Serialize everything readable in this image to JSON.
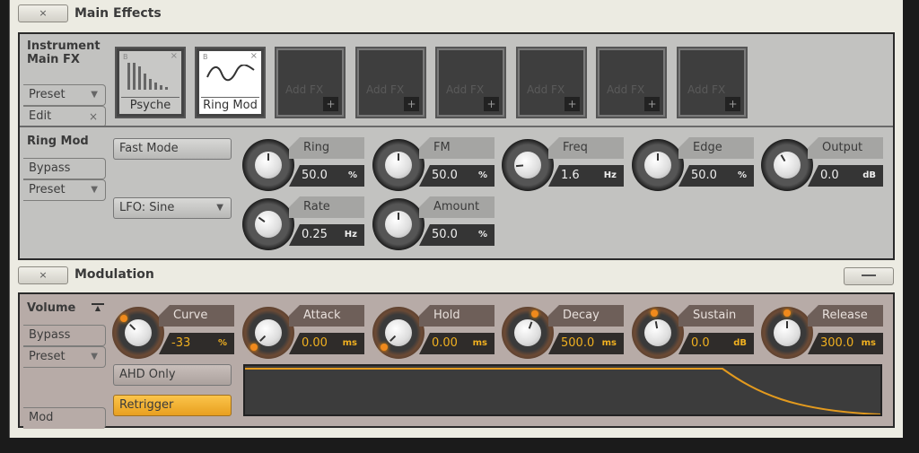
{
  "main_effects": {
    "title": "Main Effects",
    "close_label": "×",
    "section_label": "Instrument Main FX",
    "preset_label": "Preset",
    "edit_label": "Edit",
    "edit_close": "×",
    "slots": [
      {
        "name": "Psyche",
        "bypass": "B",
        "close": "×",
        "state": "loaded"
      },
      {
        "name": "Ring Mod",
        "bypass": "B",
        "close": "×",
        "state": "selected"
      },
      {
        "name": "Add FX",
        "state": "empty"
      },
      {
        "name": "Add FX",
        "state": "empty"
      },
      {
        "name": "Add FX",
        "state": "empty"
      },
      {
        "name": "Add FX",
        "state": "empty"
      },
      {
        "name": "Add FX",
        "state": "empty"
      },
      {
        "name": "Add FX",
        "state": "empty"
      }
    ],
    "plus": "+",
    "effect": {
      "title": "Ring Mod",
      "bypass_label": "Bypass",
      "preset_label": "Preset",
      "fast_mode": "Fast Mode",
      "lfo_select": "LFO: Sine",
      "knobs": [
        {
          "label": "Ring",
          "value": "50.0",
          "unit": "%",
          "angle": 0
        },
        {
          "label": "FM",
          "value": "50.0",
          "unit": "%",
          "angle": 0
        },
        {
          "label": "Freq",
          "value": "1.6",
          "unit": "Hz",
          "angle": -95
        },
        {
          "label": "Edge",
          "value": "50.0",
          "unit": "%",
          "angle": 0
        },
        {
          "label": "Output",
          "value": "0.0",
          "unit": "dB",
          "angle": -30
        },
        {
          "label": "Rate",
          "value": "0.25",
          "unit": "Hz",
          "angle": -55
        },
        {
          "label": "Amount",
          "value": "50.0",
          "unit": "%",
          "angle": 0
        }
      ]
    }
  },
  "modulation": {
    "title": "Modulation",
    "close_label": "×",
    "target": "Volume",
    "bypass_label": "Bypass",
    "preset_label": "Preset",
    "mod_tab": "Mod",
    "ahd_only": "AHD Only",
    "retrigger": "Retrigger",
    "accent": "#f0b020",
    "knobs": [
      {
        "label": "Curve",
        "value": "-33",
        "unit": "%",
        "angle": -45
      },
      {
        "label": "Attack",
        "value": "0.00",
        "unit": "ms",
        "angle": -135
      },
      {
        "label": "Hold",
        "value": "0.00",
        "unit": "ms",
        "angle": -135
      },
      {
        "label": "Decay",
        "value": "500.0",
        "unit": "ms",
        "angle": 20
      },
      {
        "label": "Sustain",
        "value": "0.0",
        "unit": "dB",
        "angle": -10
      },
      {
        "label": "Release",
        "value": "300.0",
        "unit": "ms",
        "angle": 0
      }
    ]
  }
}
